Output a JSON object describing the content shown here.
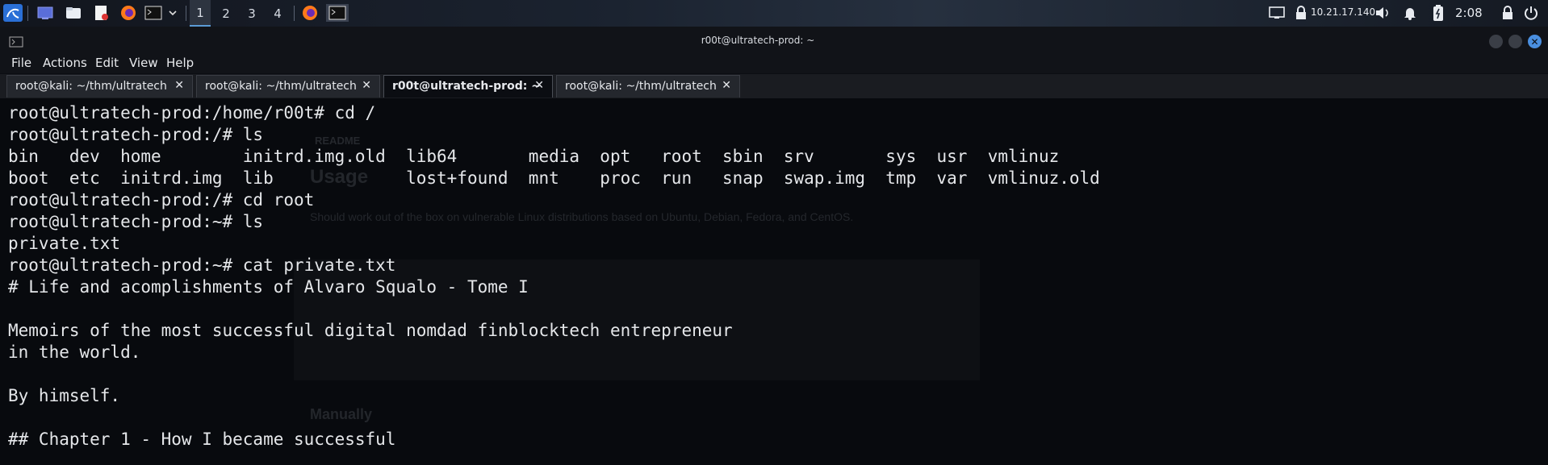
{
  "panel": {
    "workspaces": [
      "1",
      "2",
      "3",
      "4"
    ],
    "active_workspace": 0,
    "ip": "10.21.17.140",
    "clock": "2:08",
    "icons": [
      "kali-menu-icon",
      "desktop-icon",
      "file-manager-icon",
      "text-editor-icon",
      "firefox-icon",
      "terminal-icon",
      "chevron-down-icon",
      "firefox-icon",
      "terminal-icon",
      "monitor-icon",
      "vpn-lock-icon",
      "volume-icon",
      "bell-icon",
      "battery-icon",
      "lock-icon",
      "power-icon"
    ]
  },
  "window": {
    "title": "r00t@ultratech-prod: ~"
  },
  "menu": [
    "File",
    "Actions",
    "Edit",
    "View",
    "Help"
  ],
  "tabs": [
    {
      "label": "root@kali: ~/thm/ultratech",
      "close": "✕",
      "active": false
    },
    {
      "label": "root@kali: ~/thm/ultratech",
      "close": "✕",
      "active": false
    },
    {
      "label": "r00t@ultratech-prod: ~",
      "close": "✕",
      "active": true
    },
    {
      "label": "root@kali: ~/thm/ultratech",
      "close": "✕",
      "active": false
    }
  ],
  "terminal": {
    "lines": [
      "root@ultratech-prod:/home/r00t# cd /",
      "root@ultratech-prod:/# ls",
      "bin   dev  home        initrd.img.old  lib64       media  opt   root  sbin  srv       sys  usr  vmlinuz",
      "boot  etc  initrd.img  lib             lost+found  mnt    proc  run   snap  swap.img  tmp  var  vmlinuz.old",
      "root@ultratech-prod:/# cd root",
      "root@ultratech-prod:~# ls",
      "private.txt",
      "root@ultratech-prod:~# cat private.txt",
      "# Life and acomplishments of Alvaro Squalo - Tome I",
      "",
      "Memoirs of the most successful digital nomdad finblocktech entrepreneur",
      "in the world.",
      "",
      "By himself.",
      "",
      "## Chapter 1 - How I became successful"
    ]
  },
  "background": {
    "heading": "Usage",
    "text": "Should work out of the box on vulnerable Linux distributions based on Ubuntu, Debian, Fedora, and CentOS.",
    "heading2": "Manually",
    "readme": "README"
  },
  "colors": {
    "terminal_bg": "#080a0e",
    "terminal_fg": "#e5e7ea",
    "accent": "#4a8fe0"
  }
}
